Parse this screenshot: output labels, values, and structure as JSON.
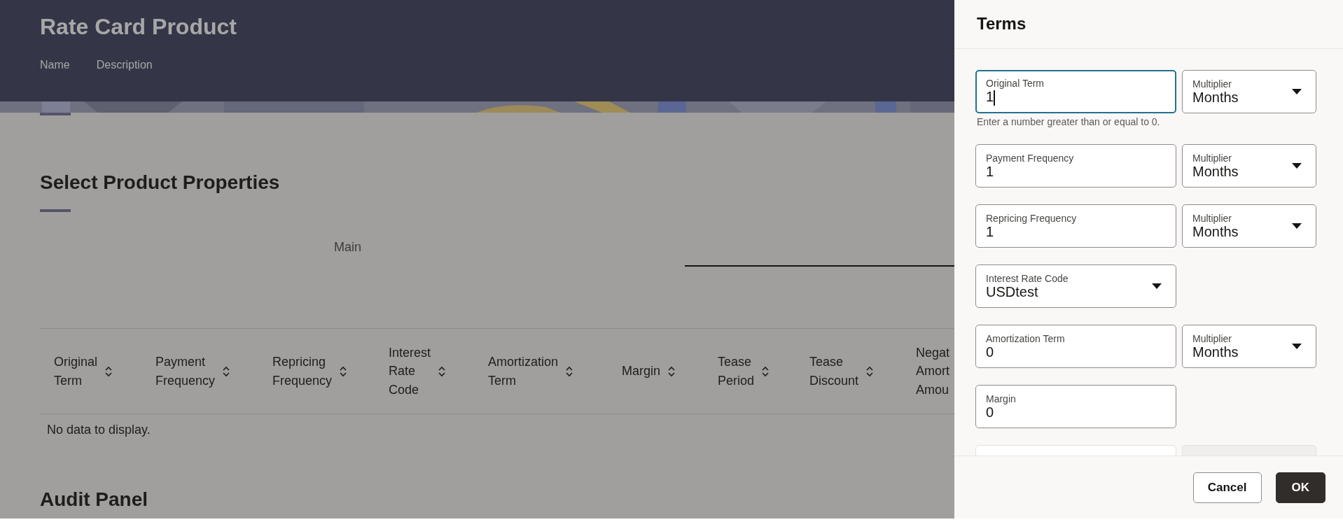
{
  "header": {
    "title": "Rate Card Product",
    "links": [
      "Name",
      "Description"
    ]
  },
  "section": {
    "title": "Select Product Properties"
  },
  "tabs": [
    {
      "label": "Main",
      "selected": false
    }
  ],
  "table": {
    "columns": [
      {
        "label": "Original\nTerm",
        "sortable": true
      },
      {
        "label": "Payment\nFrequency",
        "sortable": true
      },
      {
        "label": "Repricing\nFrequency",
        "sortable": true
      },
      {
        "label": "Interest\nRate\nCode",
        "sortable": true
      },
      {
        "label": "Amortization\nTerm",
        "sortable": true
      },
      {
        "label": "Margin",
        "sortable": true
      },
      {
        "label": "Tease\nPeriod",
        "sortable": true
      },
      {
        "label": "Tease\nDiscount",
        "sortable": true
      },
      {
        "label": "Negat\nAmort\nAmou"
      }
    ],
    "empty_text": "No data to display."
  },
  "audit": {
    "title": "Audit Panel"
  },
  "drawer": {
    "title": "Terms",
    "rows": [
      {
        "fields": [
          {
            "kind": "text",
            "label": "Original Term",
            "value": "1",
            "focused": true
          },
          {
            "kind": "select",
            "label": "Multiplier",
            "value": "Months",
            "focused": false
          }
        ],
        "hint": "Enter a number greater than or equal to 0."
      },
      {
        "fields": [
          {
            "kind": "text",
            "label": "Payment Frequency",
            "value": "1",
            "focused": false
          },
          {
            "kind": "select",
            "label": "Multiplier",
            "value": "Months",
            "focused": false
          }
        ]
      },
      {
        "fields": [
          {
            "kind": "text",
            "label": "Repricing Frequency",
            "value": "1",
            "focused": false
          },
          {
            "kind": "select",
            "label": "Multiplier",
            "value": "Months",
            "focused": false
          }
        ]
      },
      {
        "fields": [
          {
            "kind": "select",
            "label": "Interest Rate Code",
            "value": "USDtest",
            "focused": false
          }
        ]
      },
      {
        "fields": [
          {
            "kind": "text",
            "label": "Amortization Term",
            "value": "0",
            "focused": false
          },
          {
            "kind": "select",
            "label": "Multiplier",
            "value": "Months",
            "focused": false
          }
        ]
      },
      {
        "fields": [
          {
            "kind": "text",
            "label": "Margin",
            "value": "0",
            "focused": false
          }
        ]
      }
    ],
    "buttons": [
      {
        "label": "Cancel",
        "kind": "secondary"
      },
      {
        "label": "OK",
        "kind": "primary"
      }
    ]
  }
}
